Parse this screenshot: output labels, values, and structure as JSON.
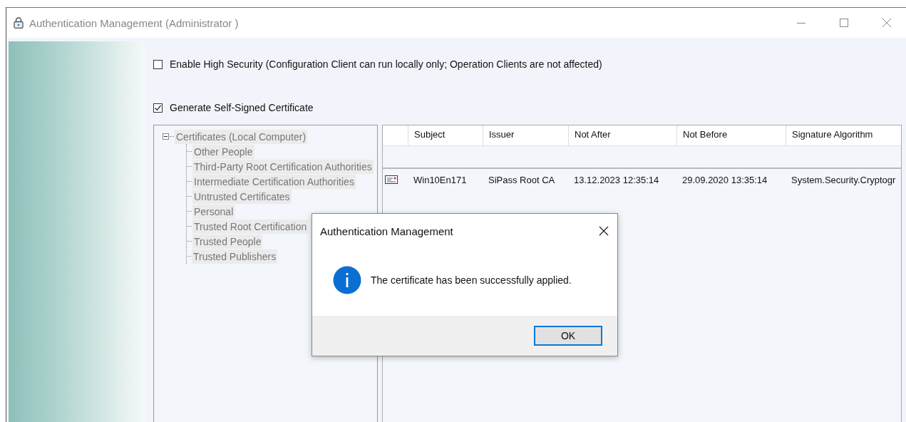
{
  "window": {
    "title": "Authentication Management  (Administrator )"
  },
  "options": [
    {
      "label": "Enable High Security (Configuration Client can run locally only; Operation Clients are not affected)",
      "checked": false
    },
    {
      "label": "Generate Self-Signed Certificate",
      "checked": true
    }
  ],
  "tree": [
    {
      "label": "Certificates (Local Computer)",
      "expanded": true,
      "children": [
        {
          "label": "Other People"
        },
        {
          "label": "Third-Party Root Certification Authorities"
        },
        {
          "label": "Intermediate Certification Authorities"
        },
        {
          "label": "Untrusted Certificates"
        },
        {
          "label": "Personal"
        },
        {
          "label": "Trusted Root Certification"
        },
        {
          "label": "Trusted People"
        },
        {
          "label": "Trusted Publishers"
        }
      ]
    }
  ],
  "table": {
    "columns": [
      "Subject",
      "Issuer",
      "Not After",
      "Not Before",
      "Signature Algorithm"
    ],
    "rows": [
      {
        "cells": [
          "Win10En171",
          "SiPass Root CA",
          "13.12.2023 12:35:14",
          "29.09.2020 13:35:14",
          "System.Security.Cryptogr"
        ]
      }
    ]
  },
  "dialog": {
    "title": "Authentication Management",
    "message": "The certificate has been successfully applied.",
    "button": "OK"
  }
}
